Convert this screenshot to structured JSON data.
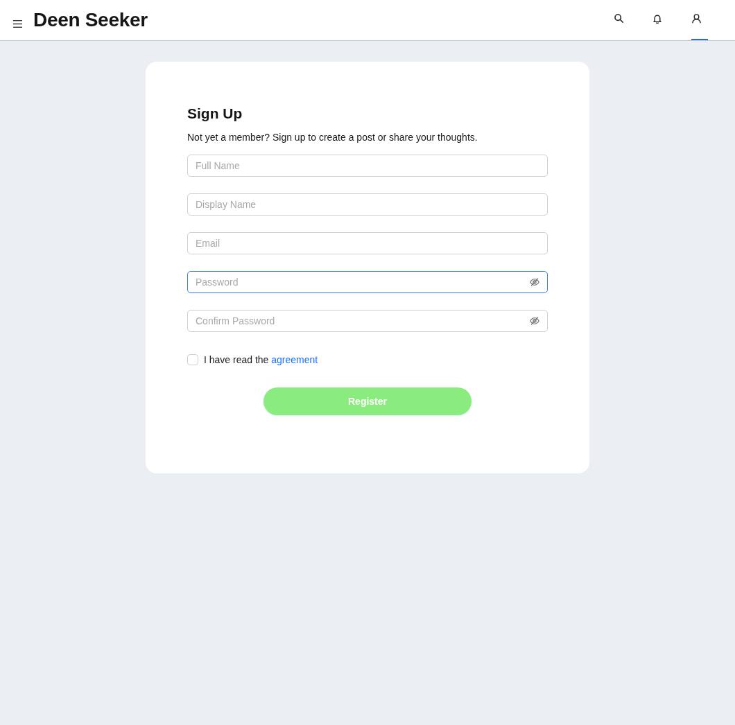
{
  "header": {
    "logo": "Deen Seeker",
    "nav": [
      {
        "kind": "search",
        "selected": false
      },
      {
        "kind": "notifications",
        "selected": false
      },
      {
        "kind": "account",
        "selected": true
      }
    ]
  },
  "form": {
    "title": "Sign Up",
    "subtitle": "Not yet a member? Sign up to create a post or share your thoughts.",
    "fields": [
      {
        "kind": "text",
        "placeholder": "Full Name",
        "focused": false
      },
      {
        "kind": "text",
        "placeholder": "Display Name",
        "focused": false
      },
      {
        "kind": "email",
        "placeholder": "Email",
        "focused": false
      },
      {
        "kind": "password",
        "placeholder": "Password",
        "focused": true
      },
      {
        "kind": "password",
        "placeholder": "Confirm Password",
        "focused": false
      }
    ],
    "agreement": {
      "text": "I have read the",
      "link": "agreement",
      "checked": false
    },
    "register_button": {
      "label": "Register",
      "disabled": true
    }
  }
}
